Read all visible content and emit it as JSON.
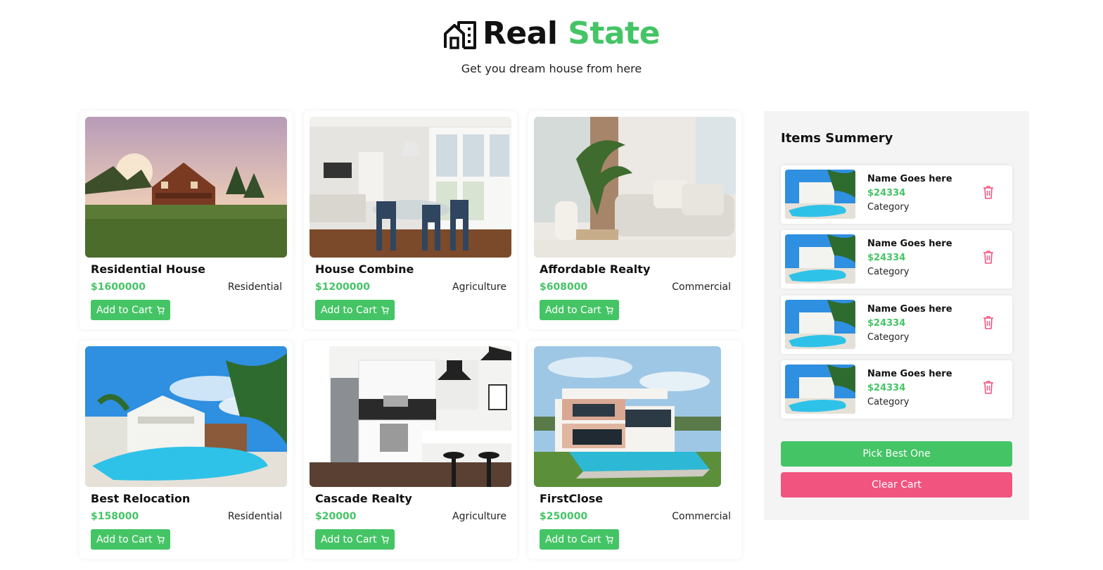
{
  "header": {
    "brand_primary": "Real",
    "brand_accent": "State",
    "tagline": "Get you dream house from here",
    "logo_icon": "building-icon"
  },
  "cart_button_label": "Add to Cart",
  "cart_icon": "cart-icon",
  "listings": [
    {
      "title": "Residential House",
      "price": "$1600000",
      "category": "Residential"
    },
    {
      "title": "House Combine",
      "price": "$1200000",
      "category": "Agriculture"
    },
    {
      "title": "Affordable Realty",
      "price": "$608000",
      "category": "Commercial"
    },
    {
      "title": "Best Relocation",
      "price": "$158000",
      "category": "Residential"
    },
    {
      "title": "Cascade Realty",
      "price": "$20000",
      "category": "Agriculture"
    },
    {
      "title": "FirstClose",
      "price": "$250000",
      "category": "Commercial"
    }
  ],
  "summary": {
    "title": "Items Summery",
    "items": [
      {
        "name": "Name Goes here",
        "price": "$24334",
        "category": "Category"
      },
      {
        "name": "Name Goes here",
        "price": "$24334",
        "category": "Category"
      },
      {
        "name": "Name Goes here",
        "price": "$24334",
        "category": "Category"
      },
      {
        "name": "Name Goes here",
        "price": "$24334",
        "category": "Category"
      }
    ],
    "delete_icon": "trash-icon",
    "pick_label": "Pick Best One",
    "clear_label": "Clear Cart"
  },
  "colors": {
    "accent_green": "#45c466",
    "danger_pink": "#f25480",
    "panel_bg": "#f4f4f4"
  }
}
